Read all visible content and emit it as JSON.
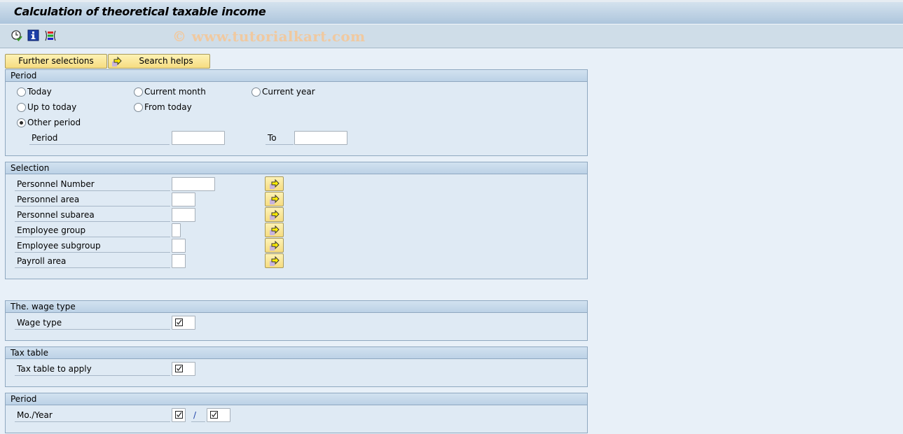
{
  "window": {
    "title": "Calculation of theoretical taxable income",
    "watermark": "© www.tutorialkart.com"
  },
  "toolbar": {
    "icons": [
      "execute-clock-icon",
      "info-icon",
      "selection-options-icon"
    ]
  },
  "buttons": {
    "further_selections": "Further selections",
    "search_helps": "Search helps"
  },
  "period_group": {
    "title": "Period",
    "options": [
      {
        "label": "Today",
        "selected": false
      },
      {
        "label": "Current month",
        "selected": false
      },
      {
        "label": "Current year",
        "selected": false
      },
      {
        "label": "Up to today",
        "selected": false
      },
      {
        "label": "From today",
        "selected": false
      },
      {
        "label": "Other period",
        "selected": true
      }
    ],
    "period_label": "Period",
    "period_from": "",
    "to_label": "To",
    "period_to": ""
  },
  "selection_group": {
    "title": "Selection",
    "fields": [
      {
        "label": "Personnel Number",
        "value": ""
      },
      {
        "label": "Personnel area",
        "value": ""
      },
      {
        "label": "Personnel subarea",
        "value": ""
      },
      {
        "label": "Employee group",
        "value": ""
      },
      {
        "label": "Employee subgroup",
        "value": ""
      },
      {
        "label": "Payroll area",
        "value": ""
      }
    ]
  },
  "wage_type_group": {
    "title": "The. wage type",
    "field_label": "Wage type",
    "required": true
  },
  "tax_table_group": {
    "title": "Tax table",
    "field_label": "Tax table to apply",
    "required": true
  },
  "period2_group": {
    "title": "Period",
    "field_label": "Mo./Year",
    "separator": "/",
    "required": true
  },
  "colors": {
    "background": "#e8f0f8",
    "button_yellow": "#f6dc80",
    "watermark": "#f0c9a0"
  }
}
